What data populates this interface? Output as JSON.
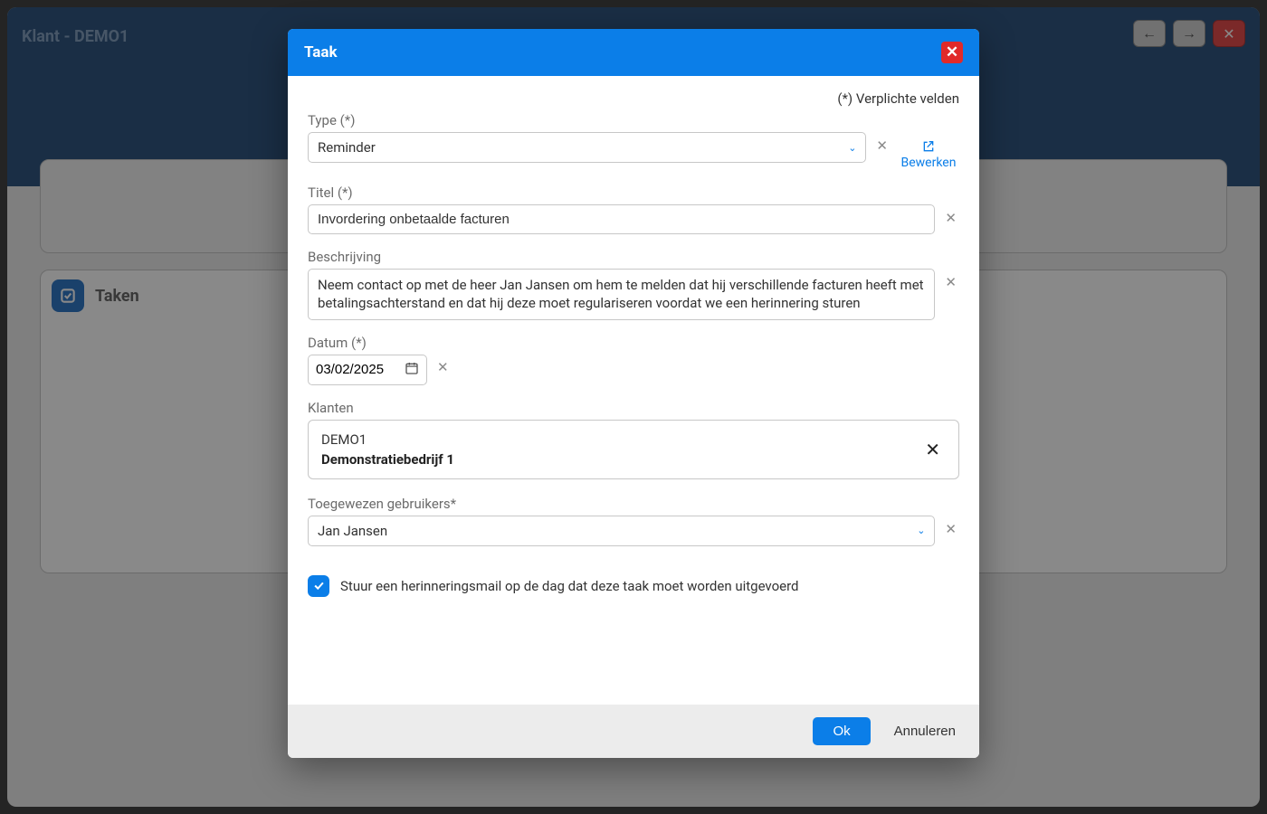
{
  "bg": {
    "title": "Klant - DEMO1",
    "panel_title": "Taken"
  },
  "modal": {
    "title": "Taak",
    "required_note": "(*) Verplichte velden",
    "type": {
      "label": "Type (*)",
      "value": "Reminder",
      "edit": "Bewerken"
    },
    "titel": {
      "label": "Titel (*)",
      "value": "Invordering onbetaalde facturen"
    },
    "beschrijving": {
      "label": "Beschrijving",
      "value": "Neem contact op met de heer Jan Jansen om hem te melden dat hij verschillende facturen heeft met betalingsachterstand en dat hij deze moet regulariseren voordat we een herinnering sturen"
    },
    "datum": {
      "label": "Datum (*)",
      "value": "03/02/2025"
    },
    "klanten": {
      "label": "Klanten",
      "code": "DEMO1",
      "name": "Demonstratiebedrijf 1"
    },
    "toegewezen": {
      "label": "Toegewezen gebruikers*",
      "value": "Jan Jansen"
    },
    "reminder_checkbox": {
      "checked": true,
      "label": "Stuur een herinneringsmail op de dag dat deze taak moet worden uitgevoerd"
    },
    "buttons": {
      "ok": "Ok",
      "cancel": "Annuleren"
    }
  }
}
